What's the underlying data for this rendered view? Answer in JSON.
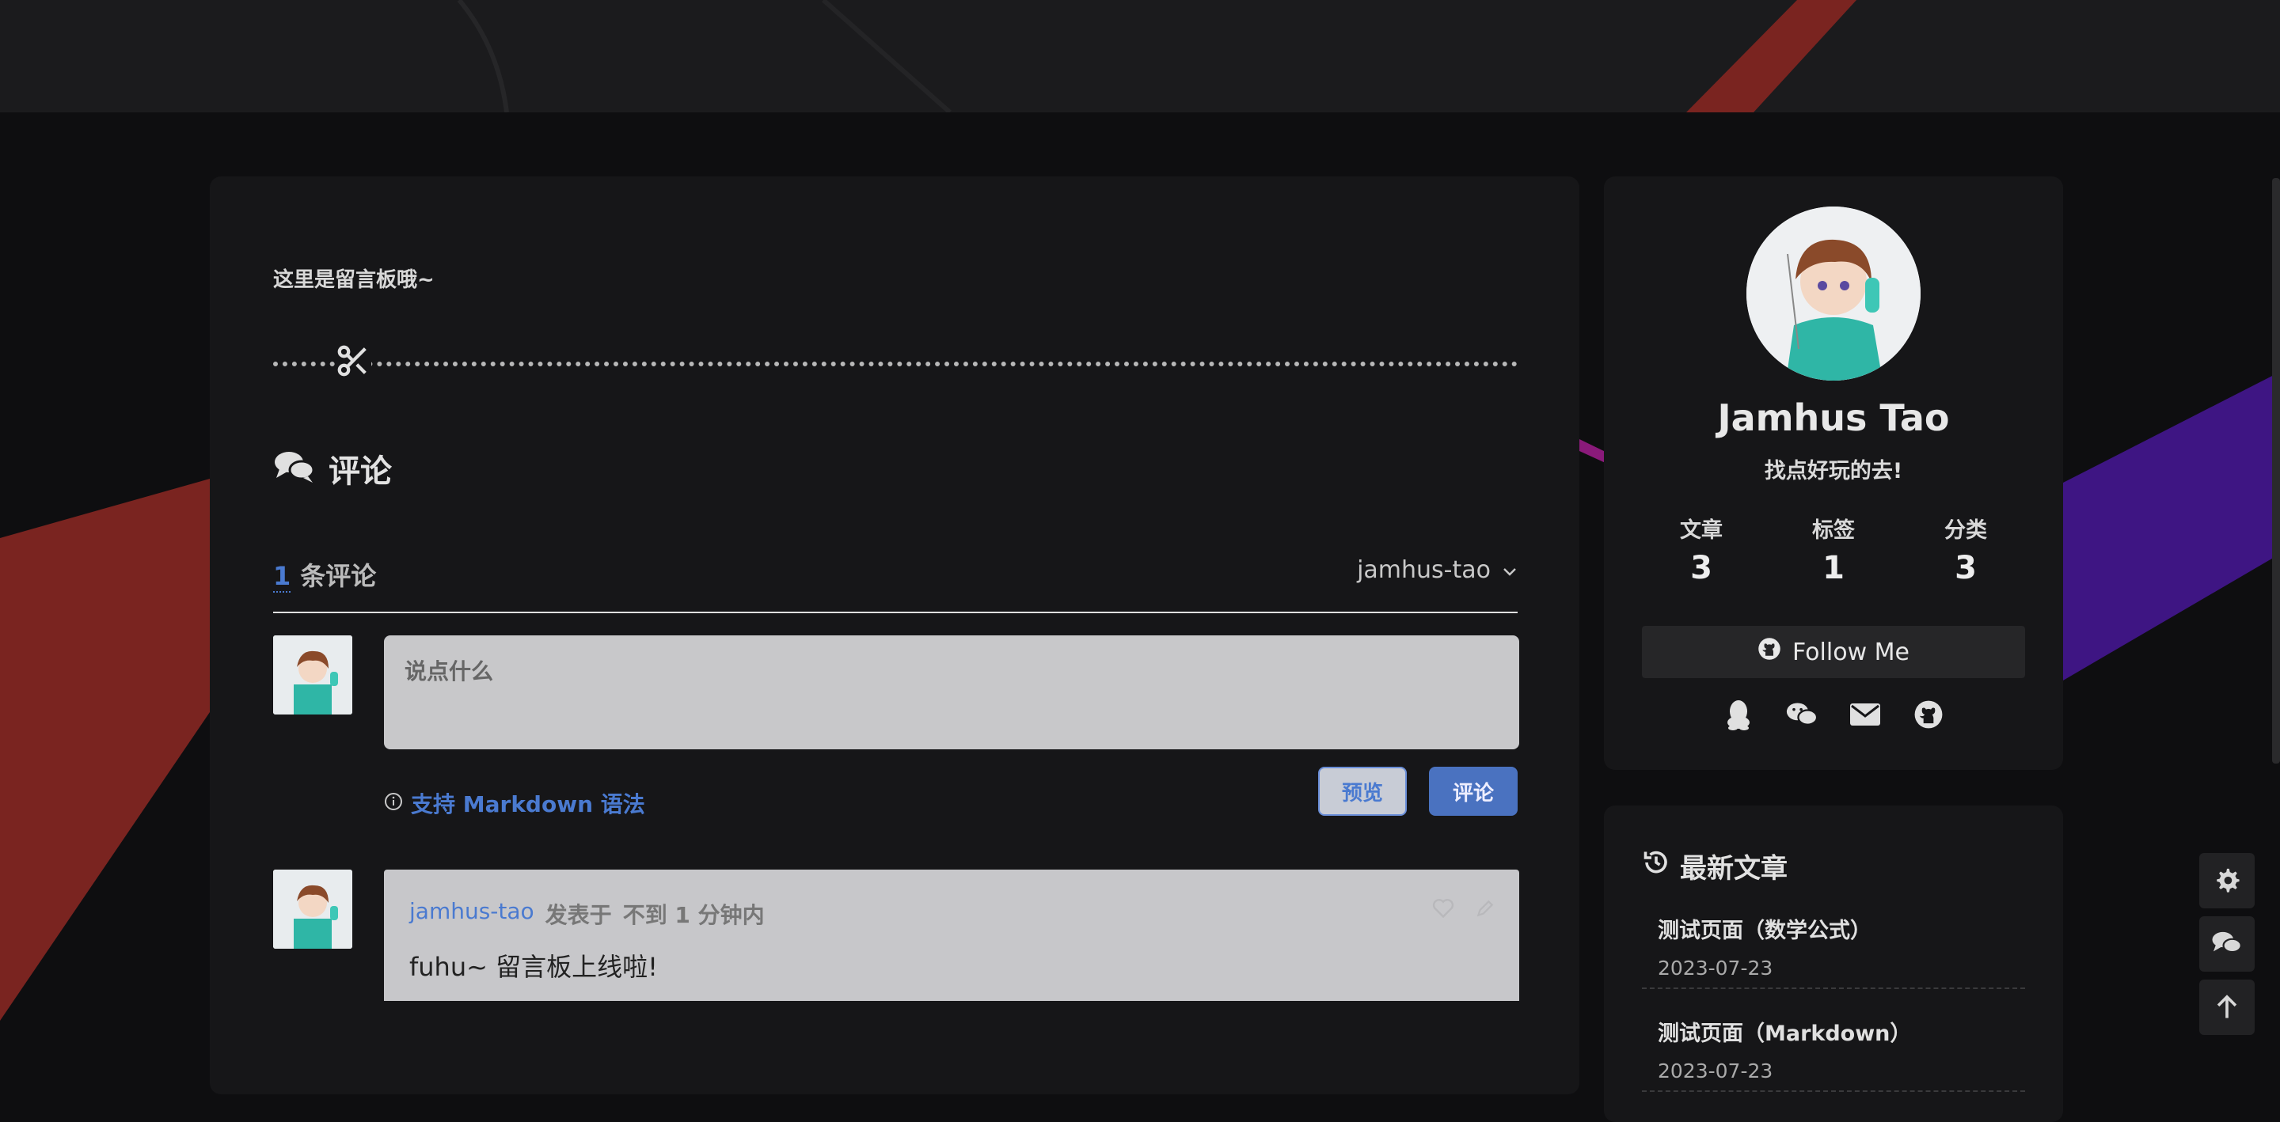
{
  "intro_text": "这里是留言板哦~",
  "comments": {
    "section_title": "评论",
    "count": "1",
    "count_suffix": "条评论",
    "current_user": "jamhus-tao",
    "input_placeholder": "说点什么",
    "markdown_hint": "支持 Markdown 语法",
    "preview_label": "预览",
    "submit_label": "评论",
    "items": [
      {
        "author": "jamhus-tao",
        "posted_label": "发表于",
        "time": "不到 1 分钟内",
        "text": "fuhu~ 留言板上线啦!"
      }
    ]
  },
  "profile": {
    "name": "Jamhus Tao",
    "motto": "找点好玩的去!",
    "stats": [
      {
        "label": "文章",
        "value": "3"
      },
      {
        "label": "标签",
        "value": "1"
      },
      {
        "label": "分类",
        "value": "3"
      }
    ],
    "follow_label": "Follow Me",
    "socials": [
      "qq-icon",
      "wechat-icon",
      "mail-icon",
      "github-icon"
    ]
  },
  "recent": {
    "title": "最新文章",
    "posts": [
      {
        "title": "测试页面（数学公式）",
        "date": "2023-07-23"
      },
      {
        "title": "测试页面（Markdown）",
        "date": "2023-07-23"
      }
    ]
  },
  "colors": {
    "accent": "#4a7ad0",
    "background": "#0e0e10",
    "card": "#161618"
  }
}
